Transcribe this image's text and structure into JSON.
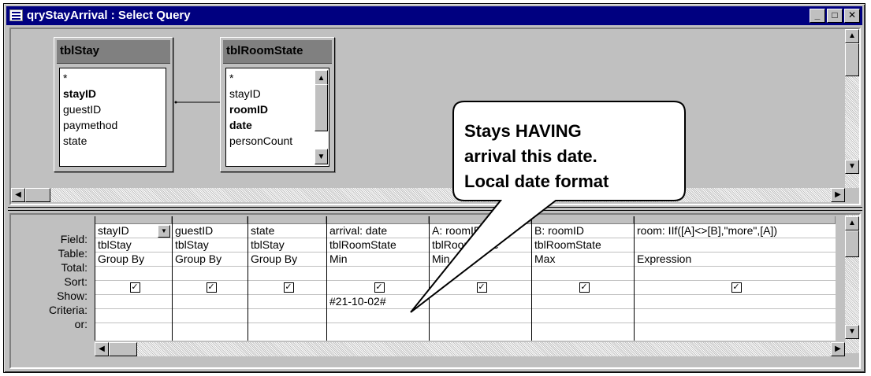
{
  "window": {
    "title": "qryStayArrival : Select Query",
    "minimize": "_",
    "maximize": "□",
    "close": "✕"
  },
  "tables": [
    {
      "name": "tblStay",
      "fields": [
        "*",
        "stayID",
        "guestID",
        "paymethod",
        "state"
      ],
      "bold": [
        1
      ]
    },
    {
      "name": "tblRoomState",
      "fields": [
        "*",
        "stayID",
        "roomID",
        "date",
        "personCount"
      ],
      "bold": [
        2,
        3
      ]
    }
  ],
  "grid": {
    "row_labels": [
      "Field:",
      "Table:",
      "Total:",
      "Sort:",
      "Show:",
      "Criteria:",
      "or:"
    ],
    "columns": [
      {
        "field": "stayID",
        "table": "tblStay",
        "total": "Group By",
        "show": true,
        "criteria": ""
      },
      {
        "field": "guestID",
        "table": "tblStay",
        "total": "Group By",
        "show": true,
        "criteria": ""
      },
      {
        "field": "state",
        "table": "tblStay",
        "total": "Group By",
        "show": true,
        "criteria": ""
      },
      {
        "field": "arrival: date",
        "table": "tblRoomState",
        "total": "Min",
        "show": true,
        "criteria": "#21-10-02#"
      },
      {
        "field": "A: roomID",
        "table": "tblRoomState",
        "total": "Min",
        "show": true,
        "criteria": ""
      },
      {
        "field": "B: roomID",
        "table": "tblRoomState",
        "total": "Max",
        "show": true,
        "criteria": ""
      },
      {
        "field": "room: IIf([A]<>[B],\"more\",[A])",
        "table": "",
        "total": "Expression",
        "show": true,
        "criteria": ""
      }
    ]
  },
  "callout": {
    "line1": "Stays HAVING",
    "line2": "arrival this date.",
    "line3": "Local date format"
  }
}
